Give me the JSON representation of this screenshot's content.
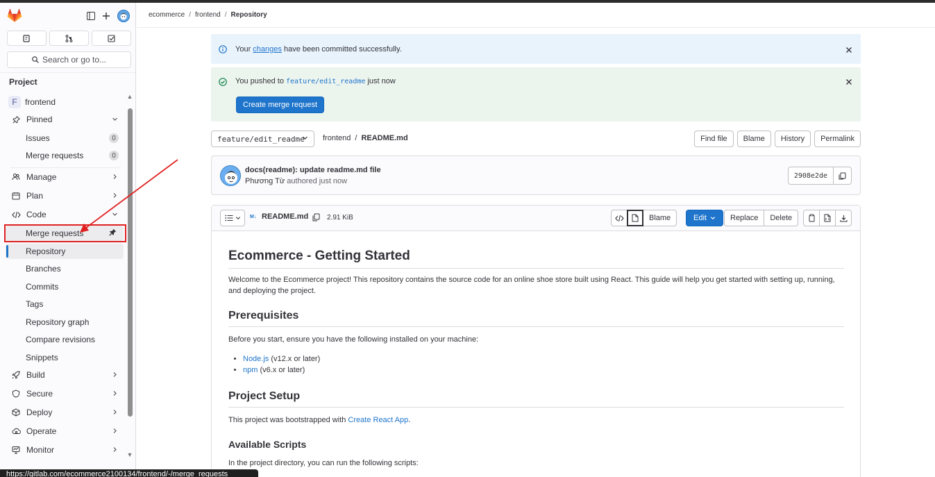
{
  "breadcrumb": [
    "ecommerce",
    "frontend",
    "Repository"
  ],
  "sidebar": {
    "search_label": "Search or go to...",
    "section_title": "Project",
    "project_initial": "F",
    "project_name": "frontend",
    "pinned_label": "Pinned",
    "pinned_items": [
      {
        "label": "Issues",
        "count": "0"
      },
      {
        "label": "Merge requests",
        "count": "0"
      }
    ],
    "manage_label": "Manage",
    "plan_label": "Plan",
    "code_label": "Code",
    "code_items": [
      "Merge requests",
      "Repository",
      "Branches",
      "Commits",
      "Tags",
      "Repository graph",
      "Compare revisions",
      "Snippets"
    ],
    "build_label": "Build",
    "secure_label": "Secure",
    "deploy_label": "Deploy",
    "operate_label": "Operate",
    "monitor_label": "Monitor"
  },
  "alerts": {
    "info_prefix": "Your",
    "info_link": "changes",
    "info_suffix": "have been committed successfully.",
    "success_prefix": "You pushed to",
    "success_branch": "feature/edit_readme",
    "success_suffix": "just now",
    "create_mr_button": "Create merge request"
  },
  "file_header": {
    "branch": "feature/edit_readme",
    "path_parent": "frontend",
    "path_file": "README.md",
    "actions": [
      "Find file",
      "Blame",
      "History",
      "Permalink"
    ]
  },
  "commit": {
    "title": "docs(readme): update readme.md file",
    "author": "Phương Từ",
    "authored_text": "authored just now",
    "sha": "2908e2de"
  },
  "file_viewer": {
    "md_badge": "M↓",
    "file_name": "README.md",
    "file_size": "2.91 KiB",
    "blame_label": "Blame",
    "edit_label": "Edit",
    "replace_label": "Replace",
    "delete_label": "Delete"
  },
  "readme": {
    "h1": "Ecommerce - Getting Started",
    "p1": "Welcome to the Ecommerce project! This repository contains the source code for an online shoe store built using React. This guide will help you get started with setting up, running, and deploying the project.",
    "h2_prereq": "Prerequisites",
    "p2": "Before you start, ensure you have the following installed on your machine:",
    "prereqs": [
      {
        "link": "Node.js",
        "text": " (v12.x or later)"
      },
      {
        "link": "npm",
        "text": " (v6.x or later)"
      }
    ],
    "h2_setup": "Project Setup",
    "p3_prefix": "This project was bootstrapped with ",
    "p3_link": "Create React App",
    "p3_suffix": ".",
    "h3_scripts": "Available Scripts",
    "p4": "In the project directory, you can run the following scripts:"
  },
  "status_url": "https://gitlab.com/ecommerce2100134/frontend/-/merge_requests",
  "colors": {
    "accent": "#1f75cb",
    "annotation": "#e02020"
  }
}
